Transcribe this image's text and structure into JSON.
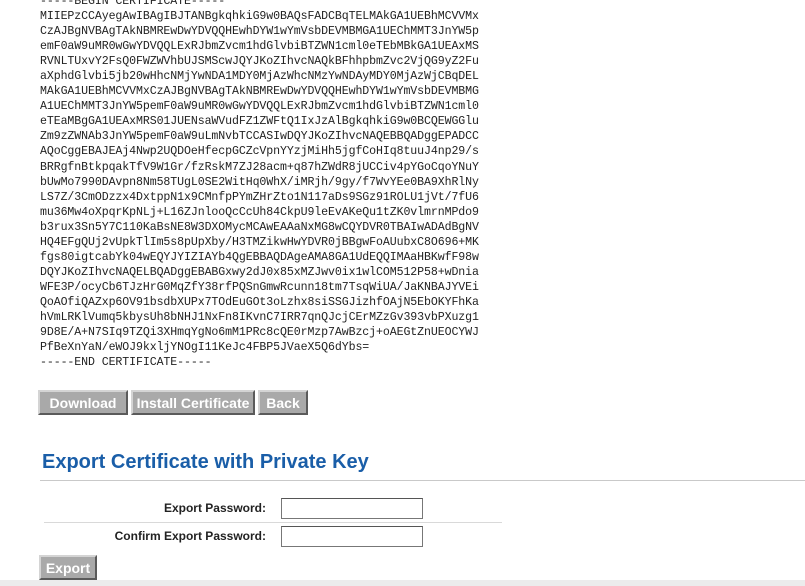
{
  "certificate": {
    "lines": [
      "-----BEGIN CERTIFICATE-----",
      "MIIEPzCCAyegAwIBAgIBJTANBgkqhkiG9w0BAQsFADCBqTELMAkGA1UEBhMCVVMx",
      "CzAJBgNVBAgTAkNBMREwDwYDVQQHEwhDYW1wYmVsbDEVMBMGA1UEChMMT3JnYW5p",
      "emF0aW9uMR0wGwYDVQQLExRJbmZvcm1hdGlvbiBTZWN1cml0eTEbMBkGA1UEAxMS",
      "RVNLTUxvY2FsQ0FWZWVhbUJSMScwJQYJKoZIhvcNAQkBFhhpbmZvc2VjQG9yZ2Fu",
      "aXphdGlvbi5jb20wHhcNMjYwNDA1MDY0MjAzWhcNMzYwNDAyMDY0MjAzWjCBqDEL",
      "MAkGA1UEBhMCVVMxCzAJBgNVBAgTAkNBMREwDwYDVQQHEwhDYW1wYmVsbDEVMBMG",
      "A1UEChMMT3JnYW5pemF0aW9uMR0wGwYDVQQLExRJbmZvcm1hdGlvbiBTZWN1cml0",
      "eTEaMBgGA1UEAxMRS01JUENsaWVudFZ1ZWFtQ1IxJzAlBgkqhkiG9w0BCQEWGGlu",
      "Zm9zZWNAb3JnYW5pemF0aW9uLmNvbTCCASIwDQYJKoZIhvcNAQEBBQADggEPADCC",
      "AQoCggEBAJEAj4Nwp2UQDOeHfecpGCZcVpnYYzjMiHh5jgfCoHIq8tuuJ4np29/s",
      "BRRgfnBtkpqakTfV9W1Gr/fzRskM7ZJ28acm+q87hZWdR8jUCCiv4pYGoCqoYNuY",
      "bUwMo7990DAvpn8Nm58TUgL0SE2WitHq0WhX/iMRjh/9gy/f7WvYEe0BA9XhRlNy",
      "LS7Z/3CmODzzx4DxtppN1x9CMnfpPYmZHrZto1N117aDs9SGz91ROLU1jVt/7fU6",
      "mu36Mw4oXpqrKpNLj+L16ZJnlooQcCcUh84CkpU9leEvAKeQu1tZK0vlmrnMPdo9",
      "b3rux3Sn5Y7C110KaBsNE8W3DXOMycMCAwEAAaNxMG8wCQYDVR0TBAIwADAdBgNV",
      "HQ4EFgQUj2vUpkTlIm5s8pUpXby/H3TMZikwHwYDVR0jBBgwFoAUubxC8O696+MK",
      "fgs80igtcabYk04wEQYJYIZIAYb4QgEBBAQDAgeAMA8GA1UdEQQIMAaHBKwfF98w",
      "DQYJKoZIhvcNAQELBQADggEBABGxwy2dJ0x85xMZJwv0ix1wlCOM512P58+wDnia",
      "WFE3P/ocyCb6TJzHrG0MqZfY38rfPQSnGmwRcunn18tm7TsqWiUA/JaKNBAJYVEi",
      "QoAOfiQAZxp6OV91bsdbXUPx7TOdEuGOt3oLzhx8siSSGJizhfOAjN5EbOKYFhKa",
      "hVmLRKlVumq5kbysUh8bNHJ1NxFn8IKvnC7IRR7qnQJcjCErMZzGv393vbPXuzg1",
      "9D8E/A+N7SIq9TZQi3XHmqYgNo6mM1PRc8cQE0rMzp7AwBzcj+oAEGtZnUEOCYWJ",
      "PfBeXnYaN/eWOJ9kxljYNOgI11KeJc4FBP5JVaeX5Q6dYbs=",
      "-----END CERTIFICATE-----"
    ]
  },
  "actions": {
    "download_label": "Download",
    "install_label": "Install Certificate",
    "back_label": "Back"
  },
  "export_section": {
    "title": "Export Certificate with Private Key",
    "export_password_label": "Export Password:",
    "export_password_value": "",
    "confirm_password_label": "Confirm Export Password:",
    "confirm_password_value": "",
    "export_label": "Export"
  },
  "colors": {
    "title": "#1a5ea8",
    "button_bg": "#a9a9a9",
    "button_text": "#ffffff"
  }
}
